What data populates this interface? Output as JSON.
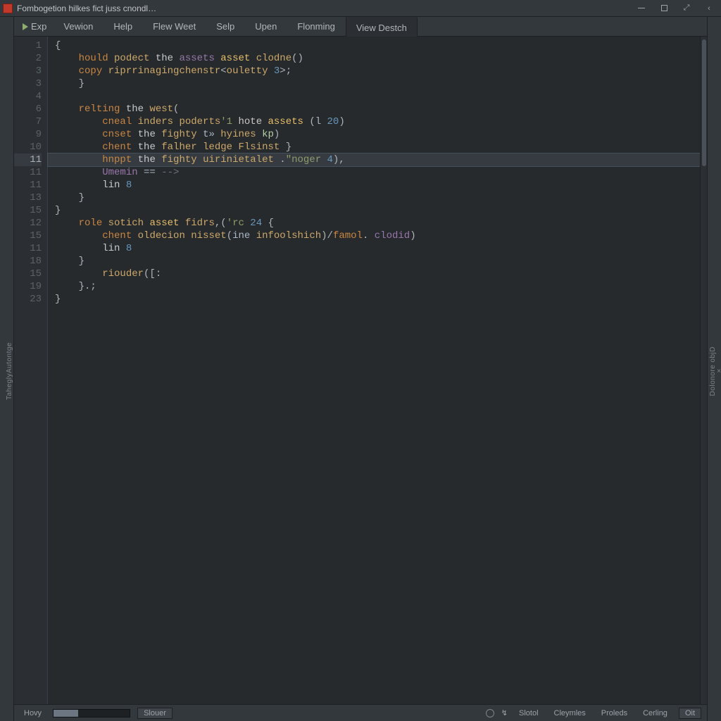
{
  "window": {
    "title": "Fombogetion hilkes fict juss cnondl…"
  },
  "left_rail": {
    "label": "TaheglyAutontge"
  },
  "right_rail": {
    "label": "Dolonore objD"
  },
  "menu": {
    "run_label": "Exp",
    "items": [
      {
        "label": "Vewion"
      },
      {
        "label": "Help"
      },
      {
        "label": "Flew Weet"
      },
      {
        "label": "Selp"
      },
      {
        "label": "Upen"
      },
      {
        "label": "Flonming"
      },
      {
        "label": "View Destch",
        "active": true
      }
    ]
  },
  "code": {
    "lines": [
      {
        "n": "1",
        "indent": 0,
        "current": false,
        "tokens": [
          [
            "t-punc",
            "{"
          ]
        ]
      },
      {
        "n": "2",
        "indent": 1,
        "current": false,
        "tokens": [
          [
            "t-kw",
            "hould "
          ],
          [
            "t-id",
            "podect "
          ],
          [
            "t-word",
            "the "
          ],
          [
            "t-type",
            "assets "
          ],
          [
            "t-fn",
            "asset "
          ],
          [
            "t-id",
            "clodne"
          ],
          [
            "t-punc",
            "()"
          ]
        ]
      },
      {
        "n": "3",
        "indent": 1,
        "current": false,
        "tokens": [
          [
            "t-kw",
            "copy "
          ],
          [
            "t-id",
            "riprrinagingchenstr"
          ],
          [
            "t-punc",
            "<"
          ],
          [
            "t-id",
            "ouletty "
          ],
          [
            "t-num",
            "3"
          ],
          [
            "t-punc",
            ">;"
          ]
        ]
      },
      {
        "n": "3",
        "indent": 1,
        "current": false,
        "tokens": [
          [
            "t-punc",
            "}"
          ]
        ]
      },
      {
        "n": "4",
        "indent": 0,
        "current": false,
        "tokens": []
      },
      {
        "n": "6",
        "indent": 1,
        "current": false,
        "tokens": [
          [
            "t-kw",
            "relting "
          ],
          [
            "t-word",
            "the "
          ],
          [
            "t-id",
            "west"
          ],
          [
            "t-punc",
            "("
          ]
        ]
      },
      {
        "n": "7",
        "indent": 2,
        "current": false,
        "tokens": [
          [
            "t-kw",
            "cneal "
          ],
          [
            "t-id",
            "inders "
          ],
          [
            "t-id",
            "poderts"
          ],
          [
            "t-str",
            "'1 "
          ],
          [
            "t-word",
            "hote "
          ],
          [
            "t-fn",
            "assets "
          ],
          [
            "t-punc",
            "("
          ],
          [
            "t-param",
            "l "
          ],
          [
            "t-num",
            "20"
          ],
          [
            "t-punc",
            ")"
          ]
        ]
      },
      {
        "n": "9",
        "indent": 2,
        "current": false,
        "tokens": [
          [
            "t-kw",
            "cnset "
          ],
          [
            "t-word",
            "the "
          ],
          [
            "t-id",
            "fighty "
          ],
          [
            "t-op",
            "t» "
          ],
          [
            "t-id",
            "hyines "
          ],
          [
            "t-hl",
            "kp"
          ],
          [
            "t-punc",
            ")"
          ]
        ]
      },
      {
        "n": "10",
        "indent": 2,
        "current": false,
        "tokens": [
          [
            "t-kw",
            "chent "
          ],
          [
            "t-word",
            "the "
          ],
          [
            "t-id",
            "falher "
          ],
          [
            "t-id",
            "ledge "
          ],
          [
            "t-id",
            "Flsinst "
          ],
          [
            "t-punc",
            "}"
          ]
        ]
      },
      {
        "n": "11",
        "indent": 2,
        "current": true,
        "tokens": [
          [
            "t-kw",
            "hnppt "
          ],
          [
            "t-word",
            "the "
          ],
          [
            "t-id",
            "fighty "
          ],
          [
            "t-id",
            "uirinietalet "
          ],
          [
            "t-punc",
            "."
          ],
          [
            "t-str",
            "\"noger "
          ],
          [
            "t-num",
            "4"
          ],
          [
            "t-punc",
            "),"
          ]
        ]
      },
      {
        "n": "11",
        "indent": 2,
        "current": false,
        "tokens": [
          [
            "t-type",
            "Umemin "
          ],
          [
            "t-op",
            "== "
          ],
          [
            "t-cmt",
            "-->"
          ]
        ]
      },
      {
        "n": "11",
        "indent": 2,
        "current": false,
        "tokens": [
          [
            "t-word",
            "lin "
          ],
          [
            "t-num",
            "8"
          ]
        ]
      },
      {
        "n": "13",
        "indent": 1,
        "current": false,
        "tokens": [
          [
            "t-punc",
            "}"
          ]
        ]
      },
      {
        "n": "15",
        "indent": 0,
        "current": false,
        "tokens": [
          [
            "t-punc",
            "}"
          ]
        ]
      },
      {
        "n": "12",
        "indent": 1,
        "current": false,
        "tokens": [
          [
            "t-kw",
            "role "
          ],
          [
            "t-id",
            "sotich "
          ],
          [
            "t-fn",
            "asset "
          ],
          [
            "t-id",
            "fidrs"
          ],
          [
            "t-punc",
            ",("
          ],
          [
            "t-str",
            "'rc "
          ],
          [
            "t-num",
            "24 "
          ],
          [
            "t-punc",
            "{"
          ]
        ]
      },
      {
        "n": "15",
        "indent": 2,
        "current": false,
        "tokens": [
          [
            "t-kw",
            "chent "
          ],
          [
            "t-id",
            "oldecion "
          ],
          [
            "t-id",
            "nisset"
          ],
          [
            "t-punc",
            "("
          ],
          [
            "t-param",
            "ine "
          ],
          [
            "t-id",
            "infoolshich"
          ],
          [
            "t-punc",
            ")/"
          ],
          [
            "t-kw2",
            "famol"
          ],
          [
            "t-punc",
            ". "
          ],
          [
            "t-type",
            "clodid"
          ],
          [
            "t-punc",
            ")"
          ]
        ]
      },
      {
        "n": "11",
        "indent": 2,
        "current": false,
        "tokens": [
          [
            "t-word",
            "lin "
          ],
          [
            "t-num",
            "8"
          ]
        ]
      },
      {
        "n": "18",
        "indent": 1,
        "current": false,
        "tokens": [
          [
            "t-punc",
            "}"
          ]
        ]
      },
      {
        "n": "15",
        "indent": 2,
        "current": false,
        "tokens": [
          [
            "t-id",
            "riouder"
          ],
          [
            "t-punc",
            "([:"
          ]
        ]
      },
      {
        "n": "19",
        "indent": 1,
        "current": false,
        "tokens": [
          [
            "t-punc",
            "}.;"
          ]
        ]
      },
      {
        "n": "23",
        "indent": 0,
        "current": false,
        "tokens": [
          [
            "t-punc",
            "}"
          ]
        ]
      }
    ]
  },
  "footer": {
    "left": "Hovy",
    "progress_text": "",
    "status": "Slouer",
    "right_items": [
      "Slotol",
      "Cleymles",
      "Proleds",
      "Cerling"
    ],
    "ok": "Oit"
  }
}
